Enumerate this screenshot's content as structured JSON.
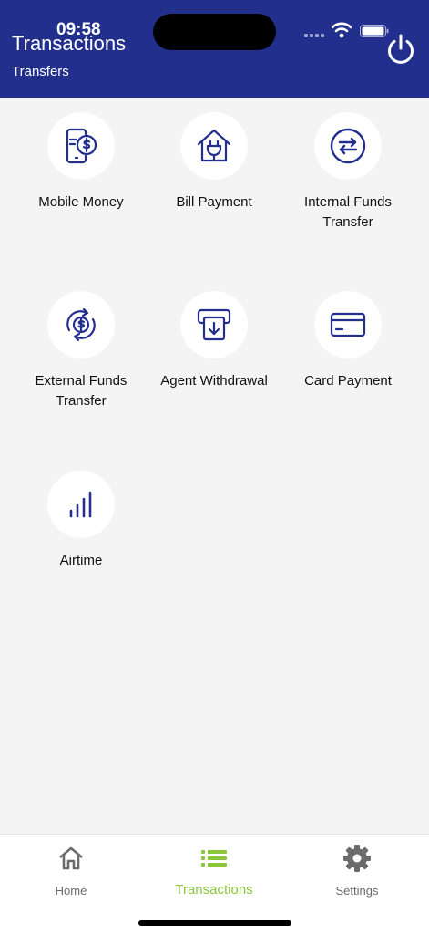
{
  "status_bar": {
    "time": "09:58"
  },
  "header": {
    "title": "Transactions",
    "subtitle": "Transfers"
  },
  "tiles": [
    {
      "label": "Mobile Money",
      "icon": "mobile-money-icon"
    },
    {
      "label": "Bill Payment",
      "icon": "bill-payment-icon"
    },
    {
      "label": "Internal Funds Transfer",
      "icon": "internal-transfer-icon"
    },
    {
      "label": "External Funds Transfer",
      "icon": "external-transfer-icon"
    },
    {
      "label": "Agent Withdrawal",
      "icon": "agent-withdrawal-icon"
    },
    {
      "label": "Card Payment",
      "icon": "card-icon"
    },
    {
      "label": "Airtime",
      "icon": "signal-bars-icon"
    }
  ],
  "bottom_nav": [
    {
      "label": "Home",
      "icon": "home-icon"
    },
    {
      "label": "Transactions",
      "icon": "list-icon",
      "active": true
    },
    {
      "label": "Settings",
      "icon": "gear-icon"
    }
  ],
  "colors": {
    "primary": "#232f8c",
    "accent": "#8cc63f",
    "background": "#f4f4f4"
  }
}
